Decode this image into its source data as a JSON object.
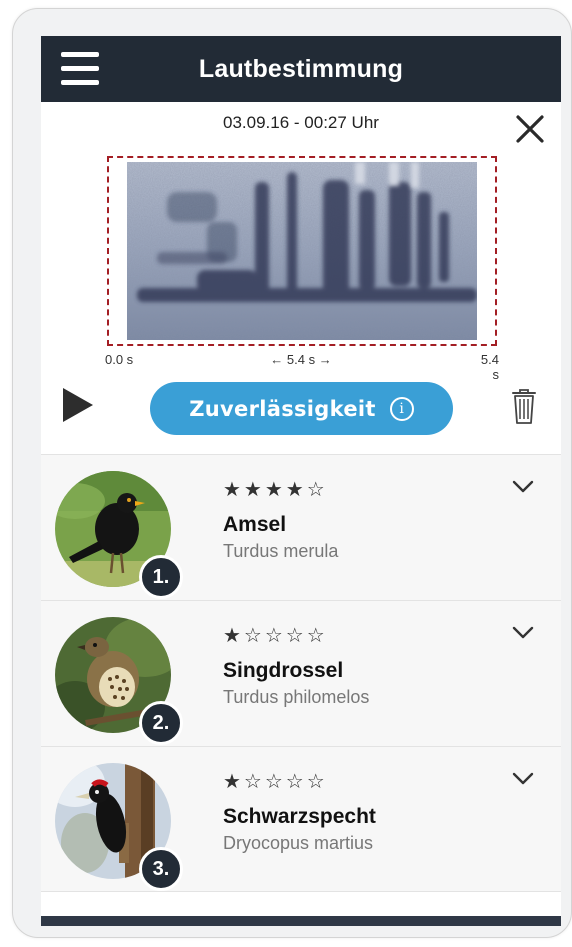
{
  "header": {
    "title": "Lautbestimmung",
    "menu_icon": "hamburger-icon"
  },
  "recording": {
    "timestamp": "03.09.16 - 00:27 Uhr",
    "axis_start": "0.0 s",
    "axis_span": "← 5.4 s →",
    "axis_end": "5.4 s",
    "selection_color": "#a31e24"
  },
  "controls": {
    "reliability_label": "Zuverlässigkeit",
    "reliability_color": "#3a9fd6",
    "info_glyph": "i",
    "play_icon": "play-icon",
    "trash_icon": "trash-icon",
    "close_icon": "close-icon"
  },
  "results": [
    {
      "rank": "1.",
      "stars": "★★★★☆",
      "rating": 4,
      "name": "Amsel",
      "latin": "Turdus merula"
    },
    {
      "rank": "2.",
      "stars": "★☆☆☆☆",
      "rating": 1,
      "name": "Singdrossel",
      "latin": "Turdus philomelos"
    },
    {
      "rank": "3.",
      "stars": "★☆☆☆☆",
      "rating": 1,
      "name": "Schwarzspecht",
      "latin": "Dryocopus martius"
    }
  ],
  "colors": {
    "header_bg": "#222b36",
    "accent": "#3a9fd6",
    "row_bg": "#f7f7f7"
  }
}
